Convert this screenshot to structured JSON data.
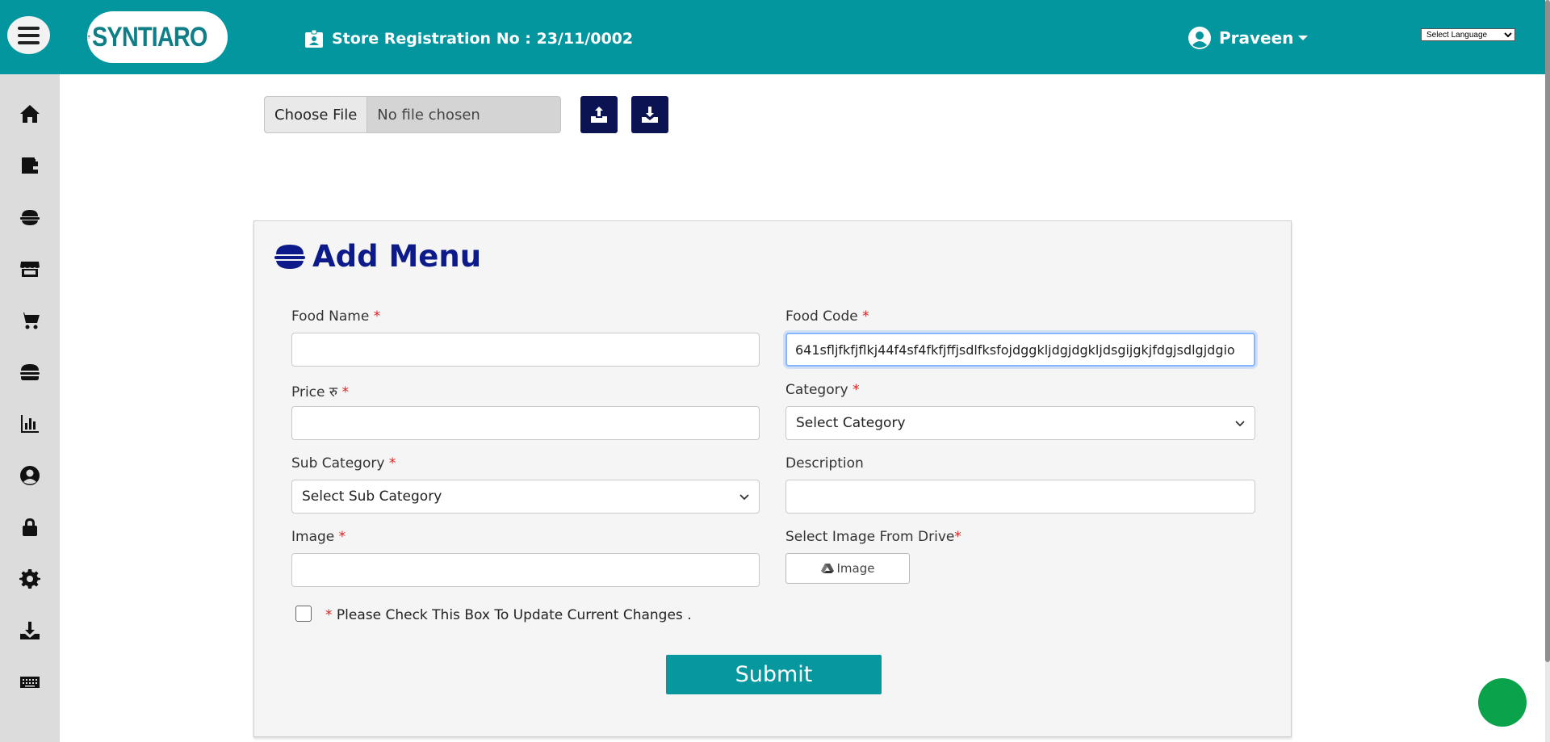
{
  "header": {
    "logo_text": "SYNTIARO",
    "store_registration": "Store Registration No : 23/11/0002",
    "user_name": "Praveen",
    "language_select": "Select Language"
  },
  "sidebar": {
    "items": [
      {
        "icon": "home-icon"
      },
      {
        "icon": "wallet-icon"
      },
      {
        "icon": "food-bowl-icon"
      },
      {
        "icon": "store-icon"
      },
      {
        "icon": "cart-icon"
      },
      {
        "icon": "burger-icon"
      },
      {
        "icon": "chart-icon"
      },
      {
        "icon": "user-circle-icon"
      },
      {
        "icon": "lock-icon"
      },
      {
        "icon": "gear-icon"
      },
      {
        "icon": "download-icon"
      },
      {
        "icon": "keyboard-icon"
      }
    ]
  },
  "upload": {
    "choose_file_label": "Choose File",
    "file_status": "No file chosen"
  },
  "form": {
    "title": "Add Menu",
    "food_name_label": "Food Name",
    "food_name_value": "",
    "food_code_label": "Food Code",
    "food_code_value": "641sfljfkfjflkj44f4sf4fkfjffjsdlfksfojdggkljdgjdgkljdsgijgkjfdgjsdlgjdgio",
    "price_label": "Price रु",
    "price_value": "",
    "category_label": "Category",
    "category_value": "Select Category",
    "sub_category_label": "Sub Category",
    "sub_category_value": "Select Sub Category",
    "description_label": "Description",
    "description_value": "",
    "image_label": "Image",
    "image_value": "",
    "drive_label": "Select Image From Drive",
    "drive_button": "Image",
    "required_mark": "*",
    "checkbox_label": "Please Check This Box To Update Current Changes .",
    "submit_label": "Submit"
  },
  "colors": {
    "header_bg": "#04969f",
    "title": "#0c1a8a",
    "dark_button": "#0c1352",
    "required": "#e02020",
    "chat_bubble": "#0aa24a"
  }
}
